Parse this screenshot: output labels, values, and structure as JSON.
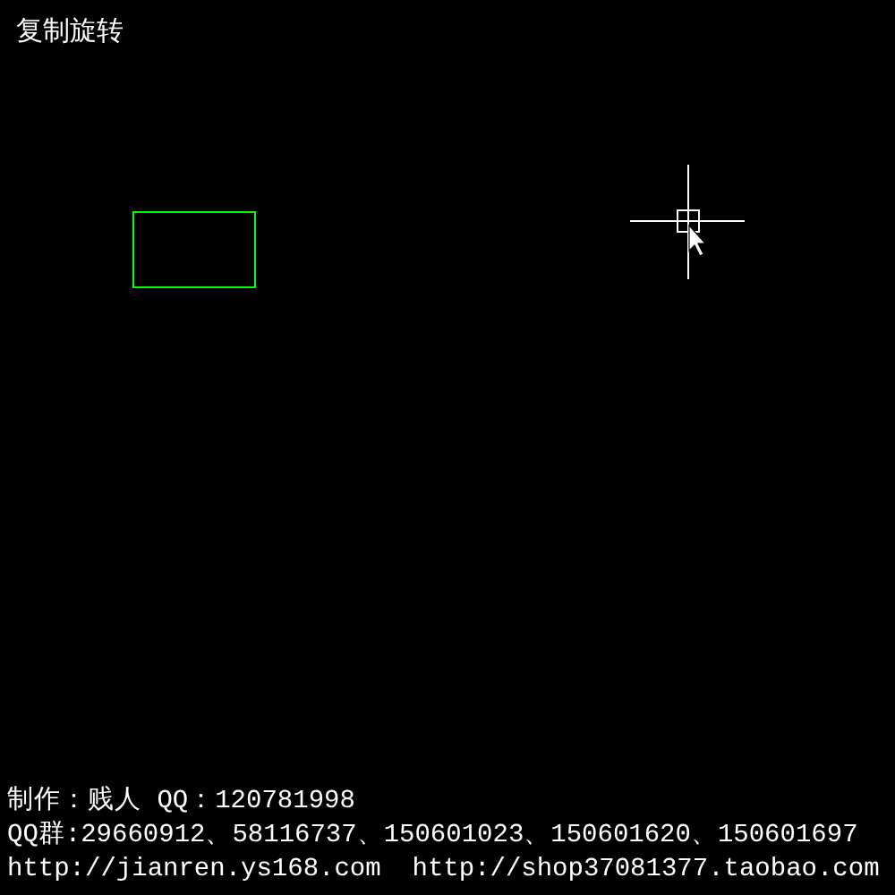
{
  "title": "复制旋转",
  "credits": [
    "制作：贱人 QQ：120781998",
    "QQ群:29660912、58116737、150601023、150601620、150601697",
    "http://jianren.ys168.com  http://shop37081377.taobao.com"
  ]
}
